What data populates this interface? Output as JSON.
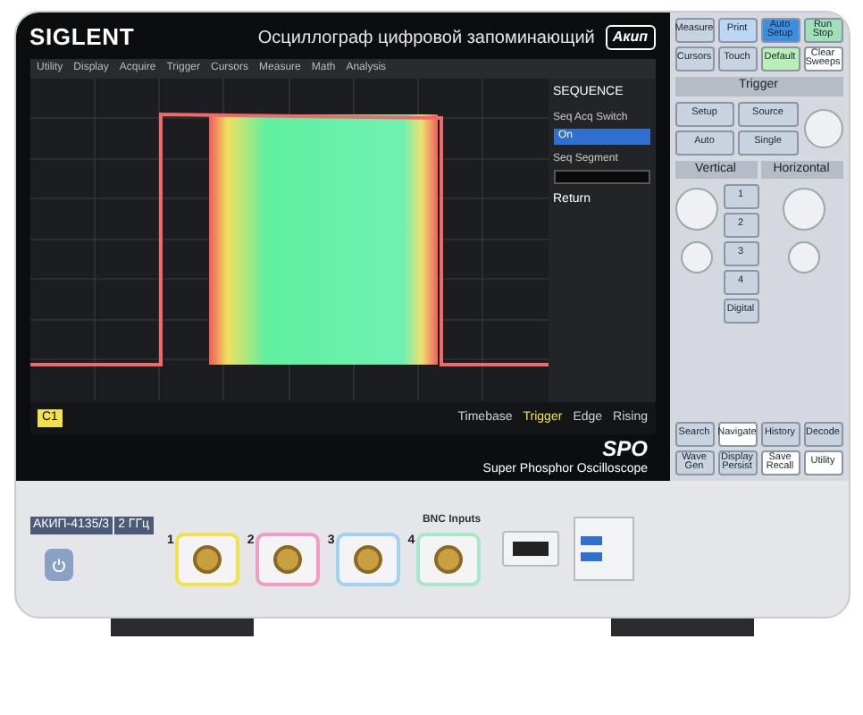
{
  "brand": "SIGLENT",
  "title": "Осциллограф цифровой запоминающий",
  "badge": "Акип",
  "menu": [
    "Utility",
    "Display",
    "Acquire",
    "Trigger",
    "Cursors",
    "Measure",
    "Math",
    "Analysis"
  ],
  "side_menu": {
    "title": "SEQUENCE",
    "items": [
      {
        "label": "Seq Acq Switch",
        "value": "On"
      },
      {
        "label": "Seq Segment"
      }
    ],
    "return": "Return"
  },
  "status": {
    "channel": "C1",
    "timebase": "Timebase",
    "trigger": "Trigger",
    "edge": "Edge",
    "slope": "Rising"
  },
  "logo": "SPO",
  "subtitle": "Super Phosphor Oscilloscope",
  "model": "АКИП-4135/3",
  "bandwidth": "2 ГГц",
  "inputs_label": "BNC Inputs",
  "channels": [
    {
      "label": "1",
      "color": "#f2e14a"
    },
    {
      "label": "2",
      "color": "#f29bc4"
    },
    {
      "label": "3",
      "color": "#9fd3f0"
    },
    {
      "label": "4",
      "color": "#a8e8c8"
    }
  ],
  "top_buttons": [
    {
      "label": "Measure",
      "color": "#c9d3df"
    },
    {
      "label": "Print",
      "color": "#bcd6f5"
    },
    {
      "label": "Auto Setup",
      "color": "#3b8fe0"
    },
    {
      "label": "Run Stop",
      "color": "#9fe0b8"
    },
    {
      "label": "Cursors",
      "color": "#c9d3df"
    },
    {
      "label": "Touch",
      "color": "#c9d3df"
    },
    {
      "label": "Default",
      "color": "#b8f0b8"
    },
    {
      "label": "Clear Sweeps",
      "color": "#ffffff"
    }
  ],
  "trigger_title": "Trigger",
  "trigger_buttons": [
    "Setup",
    "Source",
    "Auto",
    "Single"
  ],
  "vertical_title": "Vertical",
  "vertical_buttons": [
    "1",
    "2",
    "3",
    "4",
    "Digital"
  ],
  "horizontal_title": "Horizontal",
  "bottom_buttons": [
    {
      "label": "Search",
      "color": "#c9d3df"
    },
    {
      "label": "Navigate",
      "color": "#ffffff"
    },
    {
      "label": "History",
      "color": "#c9d3df"
    },
    {
      "label": "Decode",
      "color": "#c9d3df"
    },
    {
      "label": "Wave Gen",
      "color": "#c9d3df"
    },
    {
      "label": "Display Persist",
      "color": "#c9d3df"
    },
    {
      "label": "Save Recall",
      "color": "#ffffff"
    },
    {
      "label": "Utility",
      "color": "#ffffff"
    }
  ]
}
